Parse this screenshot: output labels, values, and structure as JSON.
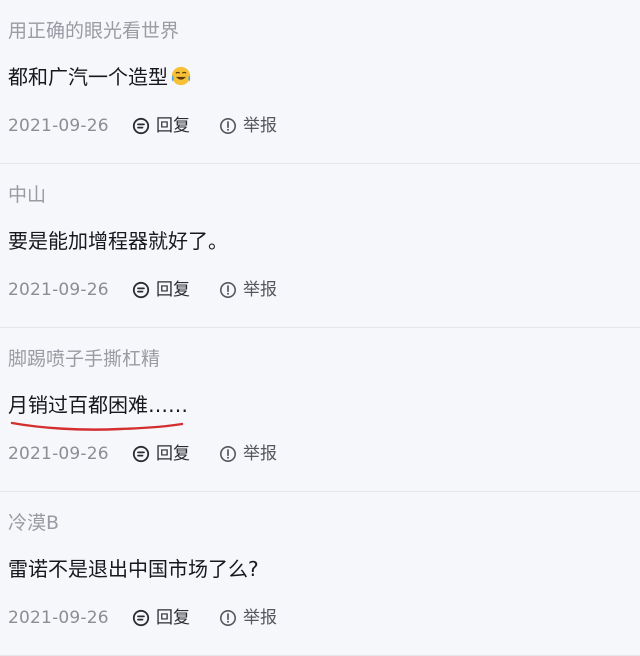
{
  "comments": [
    {
      "author": "用正确的眼光看世界",
      "content": "都和广汽一个造型",
      "emoji": "crying-laughing-emoji",
      "date": "2021-09-26",
      "reply_label": "回复",
      "report_label": "举报"
    },
    {
      "author": "中山",
      "content": "要是能加增程器就好了。",
      "date": "2021-09-26",
      "reply_label": "回复",
      "report_label": "举报"
    },
    {
      "author": "脚踢喷子手撕杠精",
      "content": "月销过百都困难……",
      "date": "2021-09-26",
      "reply_label": "回复",
      "report_label": "举报"
    },
    {
      "author": "冷漠B",
      "content": "雷诺不是退出中国市场了么?",
      "date": "2021-09-26",
      "reply_label": "回复",
      "report_label": "举报"
    }
  ],
  "colors": {
    "background": "#f6f7fb",
    "author_text": "#9a9ba3",
    "content_text": "#17181d",
    "meta_text": "#8c8d95",
    "annotation_underline": "#d32f2f"
  }
}
